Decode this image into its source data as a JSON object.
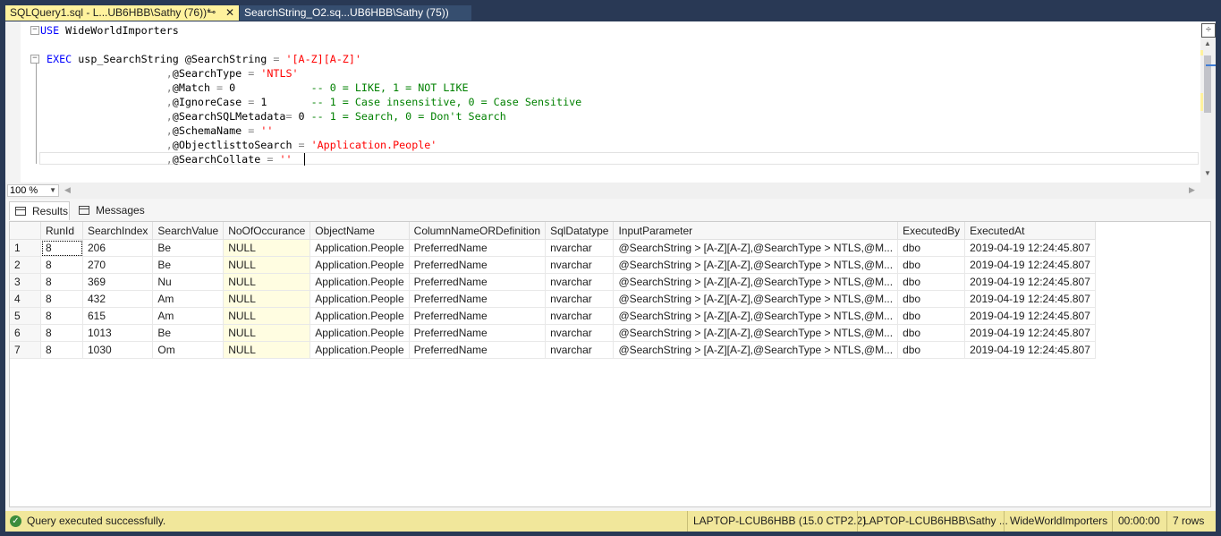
{
  "tabs": [
    {
      "label": "SQLQuery1.sql - L...UB6HBB\\Sathy (76))*",
      "pin": "⊸",
      "close": "✕"
    },
    {
      "label": "SearchString_O2.sq...UB6HBB\\Sathy (75))"
    }
  ],
  "editor": {
    "lines": [
      [
        {
          "c": "kw",
          "t": "USE"
        },
        {
          "c": "pl",
          "t": " WideWorldImporters"
        }
      ],
      [],
      [
        {
          "c": "pl",
          "t": " "
        },
        {
          "c": "kw",
          "t": "EXEC"
        },
        {
          "c": "pl",
          "t": " usp_SearchString @SearchString "
        },
        {
          "c": "op",
          "t": "="
        },
        {
          "c": "pl",
          "t": " "
        },
        {
          "c": "str",
          "t": "'[A-Z][A-Z]'"
        }
      ],
      [
        {
          "c": "pl",
          "t": "                    "
        },
        {
          "c": "op",
          "t": ","
        },
        {
          "c": "pl",
          "t": "@SearchType "
        },
        {
          "c": "op",
          "t": "="
        },
        {
          "c": "pl",
          "t": " "
        },
        {
          "c": "str",
          "t": "'NTLS'"
        }
      ],
      [
        {
          "c": "pl",
          "t": "                    "
        },
        {
          "c": "op",
          "t": ","
        },
        {
          "c": "pl",
          "t": "@Match "
        },
        {
          "c": "op",
          "t": "="
        },
        {
          "c": "pl",
          "t": " 0            "
        },
        {
          "c": "com",
          "t": "-- 0 = LIKE, 1 = NOT LIKE"
        }
      ],
      [
        {
          "c": "pl",
          "t": "                    "
        },
        {
          "c": "op",
          "t": ","
        },
        {
          "c": "pl",
          "t": "@IgnoreCase "
        },
        {
          "c": "op",
          "t": "="
        },
        {
          "c": "pl",
          "t": " 1       "
        },
        {
          "c": "com",
          "t": "-- 1 = Case insensitive, 0 = Case Sensitive"
        }
      ],
      [
        {
          "c": "pl",
          "t": "                    "
        },
        {
          "c": "op",
          "t": ","
        },
        {
          "c": "pl",
          "t": "@SearchSQLMetadata"
        },
        {
          "c": "op",
          "t": "="
        },
        {
          "c": "pl",
          "t": " 0 "
        },
        {
          "c": "com",
          "t": "-- 1 = Search, 0 = Don't Search"
        }
      ],
      [
        {
          "c": "pl",
          "t": "                    "
        },
        {
          "c": "op",
          "t": ","
        },
        {
          "c": "pl",
          "t": "@SchemaName "
        },
        {
          "c": "op",
          "t": "="
        },
        {
          "c": "pl",
          "t": " "
        },
        {
          "c": "str",
          "t": "''"
        }
      ],
      [
        {
          "c": "pl",
          "t": "                    "
        },
        {
          "c": "op",
          "t": ","
        },
        {
          "c": "pl",
          "t": "@ObjectlisttoSearch "
        },
        {
          "c": "op",
          "t": "="
        },
        {
          "c": "pl",
          "t": " "
        },
        {
          "c": "str",
          "t": "'Application.People'"
        }
      ],
      [
        {
          "c": "pl",
          "t": "                    "
        },
        {
          "c": "op",
          "t": ","
        },
        {
          "c": "pl",
          "t": "@SearchCollate "
        },
        {
          "c": "op",
          "t": "="
        },
        {
          "c": "pl",
          "t": " "
        },
        {
          "c": "str",
          "t": "''"
        }
      ]
    ],
    "split_icon": "÷"
  },
  "zoom": {
    "value": "100 %"
  },
  "result_tabs": {
    "results": "Results",
    "messages": "Messages"
  },
  "grid": {
    "columns": [
      "RunId",
      "SearchIndex",
      "SearchValue",
      "NoOfOccurance",
      "ObjectName",
      "ColumnNameORDefinition",
      "SqlDatatype",
      "InputParameter",
      "ExecutedBy",
      "ExecutedAt"
    ],
    "rows": [
      [
        "1",
        "8",
        "206",
        "Be",
        "NULL",
        "Application.People",
        "PreferredName",
        "nvarchar",
        "@SearchString > [A-Z][A-Z],@SearchType > NTLS,@M...",
        "dbo",
        "2019-04-19 12:24:45.807"
      ],
      [
        "2",
        "8",
        "270",
        "Be",
        "NULL",
        "Application.People",
        "PreferredName",
        "nvarchar",
        "@SearchString > [A-Z][A-Z],@SearchType > NTLS,@M...",
        "dbo",
        "2019-04-19 12:24:45.807"
      ],
      [
        "3",
        "8",
        "369",
        "Nu",
        "NULL",
        "Application.People",
        "PreferredName",
        "nvarchar",
        "@SearchString > [A-Z][A-Z],@SearchType > NTLS,@M...",
        "dbo",
        "2019-04-19 12:24:45.807"
      ],
      [
        "4",
        "8",
        "432",
        "Am",
        "NULL",
        "Application.People",
        "PreferredName",
        "nvarchar",
        "@SearchString > [A-Z][A-Z],@SearchType > NTLS,@M...",
        "dbo",
        "2019-04-19 12:24:45.807"
      ],
      [
        "5",
        "8",
        "615",
        "Am",
        "NULL",
        "Application.People",
        "PreferredName",
        "nvarchar",
        "@SearchString > [A-Z][A-Z],@SearchType > NTLS,@M...",
        "dbo",
        "2019-04-19 12:24:45.807"
      ],
      [
        "6",
        "8",
        "1013",
        "Be",
        "NULL",
        "Application.People",
        "PreferredName",
        "nvarchar",
        "@SearchString > [A-Z][A-Z],@SearchType > NTLS,@M...",
        "dbo",
        "2019-04-19 12:24:45.807"
      ],
      [
        "7",
        "8",
        "1030",
        "Om",
        "NULL",
        "Application.People",
        "PreferredName",
        "nvarchar",
        "@SearchString > [A-Z][A-Z],@SearchType > NTLS,@M...",
        "dbo",
        "2019-04-19 12:24:45.807"
      ]
    ]
  },
  "status": {
    "message": "Query executed successfully.",
    "server": "LAPTOP-LCUB6HBB (15.0 CTP2.2)",
    "user": "LAPTOP-LCUB6HBB\\Sathy ...",
    "database": "WideWorldImporters",
    "elapsed": "00:00:00",
    "rows": "7 rows"
  },
  "colors": {
    "tab_active": "#fff29d",
    "status_bar": "#f1e79b",
    "frame": "#293955",
    "ok_icon": "#3c8c3c"
  }
}
